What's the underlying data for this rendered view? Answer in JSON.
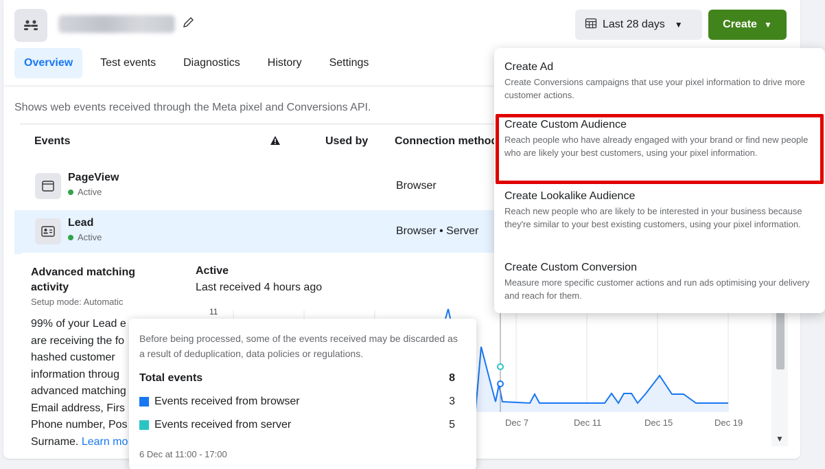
{
  "header": {
    "date_range": "Last 28 days",
    "create_label": "Create"
  },
  "tabs": [
    "Overview",
    "Test events",
    "Diagnostics",
    "History",
    "Settings"
  ],
  "description": "Shows web events received through the Meta pixel and Conversions API.",
  "table": {
    "headers": {
      "events": "Events",
      "used_by": "Used by",
      "connection": "Connection method"
    },
    "rows": [
      {
        "name": "PageView",
        "status": "Active",
        "connection": "Browser",
        "icon": "browser-window-icon"
      },
      {
        "name": "Lead",
        "status": "Active",
        "connection": "Browser • Server",
        "icon": "contact-card-icon"
      }
    ]
  },
  "detail": {
    "am_title": "Advanced matching activity",
    "am_mode": "Setup mode: Automatic",
    "am_lines": [
      "99% of your Lead e",
      "are receiving the fo",
      "hashed customer",
      "information throug",
      "advanced matching",
      "Email address, Firs",
      "Phone number, Pos"
    ],
    "am_last": "Surname. ",
    "am_link": "Learn mo",
    "status_title": "Active",
    "last_received": "Last received 4 hours ago"
  },
  "chart_data": {
    "type": "line",
    "y_tick": "11",
    "x_ticks": [
      "Dec 7",
      "Dec 11",
      "Dec 15",
      "Dec 19"
    ],
    "series": [
      {
        "color": "#1877f2"
      },
      {
        "color": "#2bc4c4"
      }
    ]
  },
  "tooltip": {
    "note": "Before being processed, some of the events received may be discarded as a result of deduplication, data policies or regulations.",
    "total_label": "Total events",
    "total_value": "8",
    "browser_label": "Events received from browser",
    "browser_value": "3",
    "server_label": "Events received from server",
    "server_value": "5",
    "time": "6 Dec at 11:00 - 17:00",
    "colors": {
      "browser": "#1877f2",
      "server": "#2bc4c4"
    }
  },
  "menu": {
    "items": [
      {
        "title": "Create Ad",
        "desc": "Create Conversions campaigns that use your pixel information to drive more customer actions."
      },
      {
        "title": "Create Custom Audience",
        "desc": "Reach people who have already engaged with your brand or find new people who are likely your best customers, using your pixel information."
      },
      {
        "title": "Create Lookalike Audience",
        "desc": "Reach new people who are likely to be interested in your business because they're similar to your best existing customers, using your pixel information."
      },
      {
        "title": "Create Custom Conversion",
        "desc": "Measure more specific customer actions and run ads optimising your delivery and reach for them."
      }
    ]
  },
  "colors": {
    "accent": "#1877f2",
    "create_green": "#42841c",
    "highlight": "#e00000"
  }
}
